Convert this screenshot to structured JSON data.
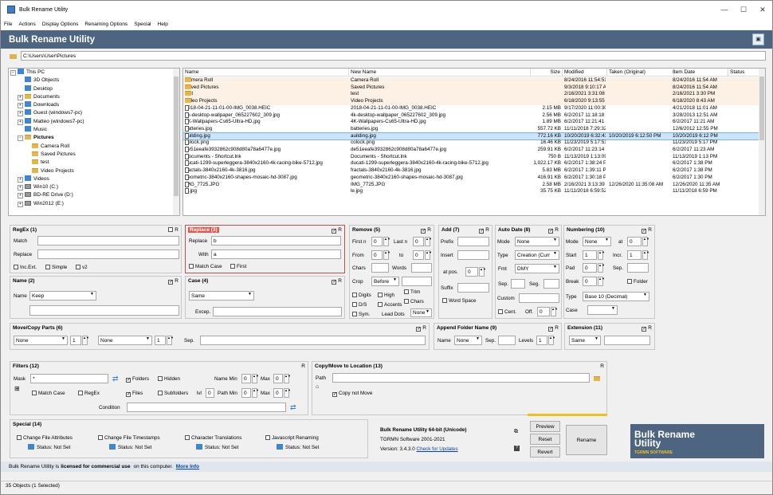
{
  "window": {
    "title": "Bulk Rename Utility",
    "banner": "Bulk Rename Utility"
  },
  "menu": [
    "File",
    "Actions",
    "Display Options",
    "Renaming Options",
    "Special",
    "Help"
  ],
  "path": "C:\\Users\\User\\Pictures",
  "tree": [
    {
      "label": "This PC",
      "indent": 0,
      "exp": "−",
      "icon": "pc"
    },
    {
      "label": "3D Objects",
      "indent": 1,
      "exp": "",
      "icon": "blue"
    },
    {
      "label": "Desktop",
      "indent": 1,
      "exp": "",
      "icon": "blue"
    },
    {
      "label": "Documents",
      "indent": 1,
      "exp": "+",
      "icon": "folder"
    },
    {
      "label": "Downloads",
      "indent": 1,
      "exp": "+",
      "icon": "blue"
    },
    {
      "label": "Guest (windows7-pc)",
      "indent": 1,
      "exp": "+",
      "icon": "blue"
    },
    {
      "label": "Matteo (windows7-pc)",
      "indent": 1,
      "exp": "+",
      "icon": "blue"
    },
    {
      "label": "Music",
      "indent": 1,
      "exp": "",
      "icon": "blue"
    },
    {
      "label": "Pictures",
      "indent": 1,
      "exp": "−",
      "icon": "folder",
      "bold": true
    },
    {
      "label": "Camera Roll",
      "indent": 2,
      "exp": "",
      "icon": "folder"
    },
    {
      "label": "Saved Pictures",
      "indent": 2,
      "exp": "",
      "icon": "folder"
    },
    {
      "label": "test",
      "indent": 2,
      "exp": "",
      "icon": "folder"
    },
    {
      "label": "Video Projects",
      "indent": 2,
      "exp": "",
      "icon": "folder"
    },
    {
      "label": "Videos",
      "indent": 1,
      "exp": "+",
      "icon": "blue"
    },
    {
      "label": "Win10 (C:)",
      "indent": 1,
      "exp": "+",
      "icon": "drive"
    },
    {
      "label": "BD-RE Drive (D:)",
      "indent": 1,
      "exp": "+",
      "icon": "drive"
    },
    {
      "label": "Win2012 (E:)",
      "indent": 1,
      "exp": "+",
      "icon": "drive"
    }
  ],
  "columns": [
    "Name",
    "New Name",
    "Size",
    "Modified",
    "Taken (Original)",
    "Item Date",
    "Status"
  ],
  "files": [
    {
      "name": "Camera Roll",
      "new": "Camera Roll",
      "size": "",
      "mod": "8/24/2016 11:54:51 AM",
      "taken": "",
      "item": "8/24/2016 11:54 AM",
      "type": "fold"
    },
    {
      "name": "Saved Pictures",
      "new": "Saved Pictures",
      "size": "",
      "mod": "9/3/2018 9:10:17 AM",
      "taken": "",
      "item": "8/24/2016 11:54 AM",
      "type": "fold"
    },
    {
      "name": "test",
      "new": "test",
      "size": "",
      "mod": "2/16/2021 3:31:08 PM",
      "taken": "",
      "item": "2/16/2021 3:30 PM",
      "type": "fold"
    },
    {
      "name": "Video Projects",
      "new": "Video Projects",
      "size": "",
      "mod": "6/18/2020 9:13:55 AM",
      "taken": "",
      "item": "6/18/2020 8:43 AM",
      "type": "fold"
    },
    {
      "name": "2018-04-21-11-01-00-IMG_0038.HEIC",
      "new": "2018-04-21-11-01-00-IMG_0038.HEIC",
      "size": "2.15 MB",
      "mod": "9/17/2020 11:00:30 PM",
      "taken": "",
      "item": "4/21/2018 11:01 AM",
      "type": "file"
    },
    {
      "name": "4k-desktop-wallpaper_065227602_309.jpg",
      "new": "4k-desktop-wallpaper_065227602_309.jpg",
      "size": "2.56 MB",
      "mod": "6/2/2017 11:18:18 AM",
      "taken": "",
      "item": "3/28/2013 12:51 AM",
      "type": "file"
    },
    {
      "name": "4K-Wallpapers-Cs65-Ultra-HD.jpg",
      "new": "4K-Wallpapers-Cs65-Ultra-HD.jpg",
      "size": "1.89 MB",
      "mod": "6/2/2017 11:21:41 AM",
      "taken": "",
      "item": "6/2/2017 11:21 AM",
      "type": "file"
    },
    {
      "name": "batteries.jpg",
      "new": "batteries.jpg",
      "size": "557.72 KB",
      "mod": "11/11/2018 7:29:32 PM",
      "taken": "",
      "item": "12/6/2012 12:55 PM",
      "type": "file"
    },
    {
      "name": "building.jpg",
      "new": "auilding.jpg",
      "size": "772.16 KB",
      "mod": "10/20/2019 6:32:43 PM",
      "taken": "10/20/2019 6:12:50 PM",
      "item": "10/20/2019 6:12 PM",
      "type": "sel"
    },
    {
      "name": "colock.png",
      "new": "colock.png",
      "size": "16.46 KB",
      "mod": "11/23/2019 5:17:51 PM",
      "taken": "",
      "item": "11/23/2019 5:17 PM",
      "type": "file"
    },
    {
      "name": "de51eeafe3932862c908d80a78a6477e.jpg",
      "new": "de51eeafe3932862c908d80a78a6477e.jpg",
      "size": "259.91 KB",
      "mod": "6/2/2017 11:23:14 AM",
      "taken": "",
      "item": "6/2/2017 11:23 AM",
      "type": "file"
    },
    {
      "name": "Documents - Shortcut.lnk",
      "new": "Documents - Shortcut.lnk",
      "size": "750 B",
      "mod": "11/13/2019 1:13:09 PM",
      "taken": "",
      "item": "11/13/2019 1:13 PM",
      "type": "file"
    },
    {
      "name": "ducati-1299-superleggera-3840x2160-4k-racing-bike-5712.jpg",
      "new": "ducati-1299-superleggera-3840x2160-4k-racing-bike-5712.jpg",
      "size": "1,022.17 KB",
      "mod": "6/2/2017 1:38:24 PM",
      "taken": "",
      "item": "6/2/2017 1:38 PM",
      "type": "file"
    },
    {
      "name": "fractals-3840x2160-4k-3816.jpg",
      "new": "fractals-3840x2160-4k-3816.jpg",
      "size": "5.83 MB",
      "mod": "6/2/2017 1:39:11 PM",
      "taken": "",
      "item": "6/2/2017 1:38 PM",
      "type": "file"
    },
    {
      "name": "geometric-3840x2160-shapes-mosaic-hd-3087.jpg",
      "new": "geometric-3840x2160-shapes-mosaic-hd-3087.jpg",
      "size": "416.91 KB",
      "mod": "6/2/2017 1:30:18 PM",
      "taken": "",
      "item": "6/2/2017 1:30 PM",
      "type": "file"
    },
    {
      "name": "IMG_7725.JPG",
      "new": "IMG_7725.JPG",
      "size": "2.58 MB",
      "mod": "2/16/2021 3:13:39 PM",
      "taken": "12/26/2020 11:35:08 AM",
      "item": "12/26/2020 11:35 AM",
      "type": "file"
    },
    {
      "name": "le.jpg",
      "new": "le.jpg",
      "size": "35.75 KB",
      "mod": "11/11/2018 6:59:52 PM",
      "taken": "",
      "item": "11/11/2018 6:59 PM",
      "type": "file"
    }
  ],
  "regex": {
    "title": "RegEx (1)",
    "r": "R",
    "match": "Match",
    "replace": "Replace",
    "incext": "Inc.Ext.",
    "simple": "Simple",
    "v2": "v2"
  },
  "replace": {
    "title": "Replace (3)",
    "r": "R",
    "replace_label": "Replace",
    "replace_val": "b",
    "with_label": "With",
    "with_val": "a",
    "matchcase": "Match Case",
    "first": "First"
  },
  "remove": {
    "title": "Remove (5)",
    "r": "R",
    "firstn": "First n",
    "firstn_val": "0",
    "lastn": "Last n",
    "lastn_val": "0",
    "from": "From",
    "from_val": "0",
    "to": "to",
    "to_val": "0",
    "chars": "Chars",
    "words": "Words",
    "crop": "Crop",
    "crop_val": "Before",
    "digits": "Digits",
    "high": "High",
    "trim": "Trim",
    "ds": "D/S",
    "accents": "Accents",
    "chars2": "Chars",
    "sym": "Sym.",
    "leaddots": "Lead Dots",
    "leaddots_val": "None"
  },
  "add": {
    "title": "Add (7)",
    "r": "R",
    "prefix": "Prefix",
    "insert": "Insert",
    "atpos": "at pos.",
    "atpos_val": "0",
    "suffix": "Suffix",
    "wordspace": "Word Space"
  },
  "autodate": {
    "title": "Auto Date (8)",
    "r": "R",
    "mode": "Mode",
    "mode_val": "None",
    "type": "Type",
    "type_val": "Creation (Curr",
    "fmt": "Fmt",
    "fmt_val": "DMY",
    "sep": "Sep.",
    "seg": "Seg.",
    "custom": "Custom",
    "cent": "Cent.",
    "off": "Off.",
    "off_val": "0"
  },
  "numbering": {
    "title": "Numbering (10)",
    "r": "R",
    "mode": "Mode",
    "mode_val": "None",
    "at": "at",
    "at_val": "0",
    "start": "Start",
    "start_val": "1",
    "incr": "Incr.",
    "incr_val": "1",
    "pad": "Pad",
    "pad_val": "0",
    "sep": "Sep.",
    "break": "Break",
    "break_val": "0",
    "folder": "Folder",
    "type": "Type",
    "type_val": "Base 10 (Decimal)",
    "case": "Case"
  },
  "name": {
    "title": "Name (2)",
    "r": "R",
    "label": "Name",
    "val": "Keep"
  },
  "case": {
    "title": "Case (4)",
    "r": "R",
    "val": "Same",
    "excep": "Excep."
  },
  "moveparts": {
    "title": "Move/Copy Parts (6)",
    "r": "R",
    "sel1": "None",
    "n1": "1",
    "sel2": "None",
    "n2": "1",
    "sep": "Sep."
  },
  "appendfolder": {
    "title": "Append Folder Name (9)",
    "r": "R",
    "name": "Name",
    "name_val": "None",
    "sep": "Sep.",
    "levels": "Levels",
    "levels_val": "1"
  },
  "extension": {
    "title": "Extension (11)",
    "r": "R",
    "val": "Same"
  },
  "filters": {
    "title": "Filters (12)",
    "r": "R",
    "mask": "Mask",
    "mask_val": "*",
    "folders": "Folders",
    "hidden": "Hidden",
    "namemin": "Name Min",
    "namemin_val": "0",
    "max": "Max",
    "max_val": "0",
    "matchcase": "Match Case",
    "regex": "RegEx",
    "files": "Files",
    "subfolders": "Subfolders",
    "lvl": "lvl",
    "lvl_val": "0",
    "pathmin": "Path Min",
    "pathmin_val": "0",
    "max2": "Max",
    "max2_val": "0",
    "condition": "Condition"
  },
  "copymove": {
    "title": "Copy/Move to Location (13)",
    "r": "R",
    "path": "Path",
    "notmove": "Copy not Move"
  },
  "special": {
    "title": "Special (14)",
    "c1": "Change File Attributes",
    "c2": "Change File Timestamps",
    "c3": "Character Translations",
    "c4": "Javascript Renaming",
    "status": "Status: Not Set"
  },
  "info": {
    "l1": "Bulk Rename Utility 64-bit (Unicode)",
    "l2": "TGRMN Software 2001-2021",
    "ver": "Version: 3.4.3.0",
    "check": "Check for Updates"
  },
  "buttons": {
    "preview": "Preview",
    "reset": "Reset",
    "revert": "Revert",
    "rename": "Rename"
  },
  "brand": {
    "l1": "Bulk Rename",
    "l2": "Utility",
    "l3": "TGRMN SOFTWARE"
  },
  "statusbar": {
    "pre": "Bulk Rename Utility is ",
    "bold": "licensed for commercial use",
    "post": " on this computer. ",
    "link": "More Info"
  },
  "bottom": "35 Objects (1 Selected)"
}
